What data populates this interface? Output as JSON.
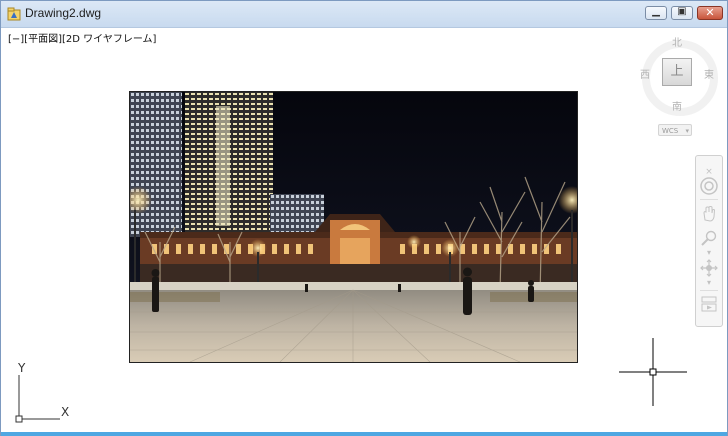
{
  "window": {
    "title": "Drawing2.dwg",
    "controls": [
      "minimize",
      "maximize",
      "close"
    ]
  },
  "viewport": {
    "label": "[−][平面図][2D ワイヤフレーム]"
  },
  "viewcube": {
    "north": "北",
    "south": "南",
    "west": "西",
    "east": "東",
    "face": "上",
    "coordinate_system": "WCS"
  },
  "navbar": {
    "items": [
      "steering-wheel",
      "pan",
      "zoom",
      "orbit",
      "showmotion"
    ]
  },
  "ucs": {
    "x_label": "X",
    "y_label": "Y"
  },
  "image": {
    "subject": "night-scene-photograph"
  },
  "colors": {
    "accent": "#4fa7e2",
    "titlebar": "#c8daef"
  }
}
